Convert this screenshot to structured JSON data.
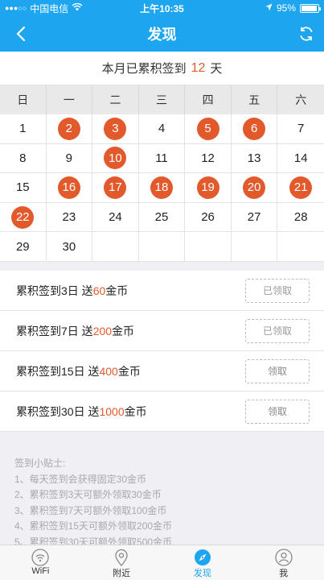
{
  "status": {
    "carrier": "中国电信",
    "time": "上午10:35",
    "battery_text": "95%",
    "battery_level": 0.95
  },
  "nav": {
    "title": "发现"
  },
  "summary": {
    "prefix": "本月已累积签到",
    "count": "12",
    "suffix": "天"
  },
  "calendar": {
    "weekdays": [
      "日",
      "一",
      "二",
      "三",
      "四",
      "五",
      "六"
    ],
    "cells": [
      {
        "day": "1",
        "signed": false
      },
      {
        "day": "2",
        "signed": true
      },
      {
        "day": "3",
        "signed": true
      },
      {
        "day": "4",
        "signed": false
      },
      {
        "day": "5",
        "signed": true
      },
      {
        "day": "6",
        "signed": true
      },
      {
        "day": "7",
        "signed": false
      },
      {
        "day": "8",
        "signed": false
      },
      {
        "day": "9",
        "signed": false
      },
      {
        "day": "10",
        "signed": true
      },
      {
        "day": "11",
        "signed": false
      },
      {
        "day": "12",
        "signed": false
      },
      {
        "day": "13",
        "signed": false
      },
      {
        "day": "14",
        "signed": false
      },
      {
        "day": "15",
        "signed": false
      },
      {
        "day": "16",
        "signed": true
      },
      {
        "day": "17",
        "signed": true
      },
      {
        "day": "18",
        "signed": true
      },
      {
        "day": "19",
        "signed": true
      },
      {
        "day": "20",
        "signed": true
      },
      {
        "day": "21",
        "signed": true
      },
      {
        "day": "22",
        "signed": true
      },
      {
        "day": "23",
        "signed": false
      },
      {
        "day": "24",
        "signed": false
      },
      {
        "day": "25",
        "signed": false
      },
      {
        "day": "26",
        "signed": false
      },
      {
        "day": "27",
        "signed": false
      },
      {
        "day": "28",
        "signed": false
      },
      {
        "day": "29",
        "signed": false
      },
      {
        "day": "30",
        "signed": false
      },
      {
        "day": "",
        "signed": false
      },
      {
        "day": "",
        "signed": false
      },
      {
        "day": "",
        "signed": false
      },
      {
        "day": "",
        "signed": false
      },
      {
        "day": "",
        "signed": false
      }
    ]
  },
  "rewards": [
    {
      "prefix": "累积签到3日 送",
      "amount": "60",
      "suffix": "金币",
      "button": "已领取",
      "claimed": true
    },
    {
      "prefix": "累积签到7日 送",
      "amount": "200",
      "suffix": "金币",
      "button": "已领取",
      "claimed": true
    },
    {
      "prefix": "累积签到15日 送",
      "amount": "400",
      "suffix": "金币",
      "button": "领取",
      "claimed": false
    },
    {
      "prefix": "累积签到30日 送",
      "amount": "1000",
      "suffix": "金币",
      "button": "领取",
      "claimed": false
    }
  ],
  "tips": {
    "title": "签到小贴士:",
    "lines": [
      "1、每天签到会获得固定30金币",
      "2、累积签到3天可额外领取30金币",
      "3、累积签到7天可额外领取100金币",
      "4、累积签到15天可额外领取200金币",
      "5、累积签到30天可额外领取500金币"
    ]
  },
  "tabs": [
    {
      "label": "WiFi",
      "icon": "wifi-icon",
      "active": false
    },
    {
      "label": "附近",
      "icon": "location-pin-icon",
      "active": false
    },
    {
      "label": "发现",
      "icon": "compass-icon",
      "active": true
    },
    {
      "label": "我",
      "icon": "user-icon",
      "active": false
    }
  ],
  "colors": {
    "brand": "#1ea5f0",
    "accent": "#e25a2c"
  }
}
